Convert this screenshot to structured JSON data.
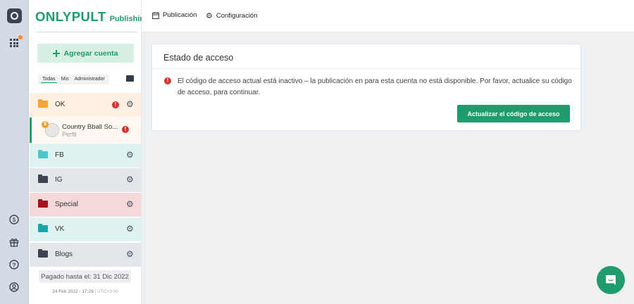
{
  "brand": {
    "name": "ONLYPULT",
    "product": "Publishing"
  },
  "sidebar": {
    "add_account": "Agregar cuenta",
    "tabs": [
      "Todas",
      "Mis",
      "Administrador"
    ],
    "groups": [
      {
        "label": "OK",
        "folder_color": "#f5a637",
        "bg": "#fff0e1",
        "has_alert": true
      },
      {
        "label": "FB",
        "folder_color": "#4fc6c9",
        "bg": "#dff4f2",
        "has_alert": false
      },
      {
        "label": "IG",
        "folder_color": "#3d4450",
        "bg": "#e3e6ea",
        "has_alert": false
      },
      {
        "label": "Special",
        "folder_color": "#a3131c",
        "bg": "#f5d9da",
        "has_alert": false
      },
      {
        "label": "VK",
        "folder_color": "#1aa5a8",
        "bg": "#dff4f2",
        "has_alert": false
      },
      {
        "label": "Blogs",
        "folder_color": "#3d4450",
        "bg": "#e3e6ea",
        "has_alert": false
      }
    ],
    "account": {
      "name": "Country Bball So...",
      "type": "Perfil"
    },
    "paid_until": "Pagado hasta el: 31 Dic 2022",
    "footer_date": "24 Feb 2022 - 17:29",
    "footer_sep": "|",
    "footer_tz": "UTC+3:00"
  },
  "topbar": {
    "publication": "Publicación",
    "settings": "Configuración"
  },
  "card": {
    "title": "Estado de acceso",
    "message": "El código de acceso actual está inactivo – la publicación en para esta cuenta no está disponible. Por favor, actualice su código de acceso, para continuar.",
    "button": "Actualizar el código de acceso"
  },
  "colors": {
    "accent": "#1e9c6c",
    "alert": "#d9302c",
    "rail": "#d5dbe6"
  }
}
